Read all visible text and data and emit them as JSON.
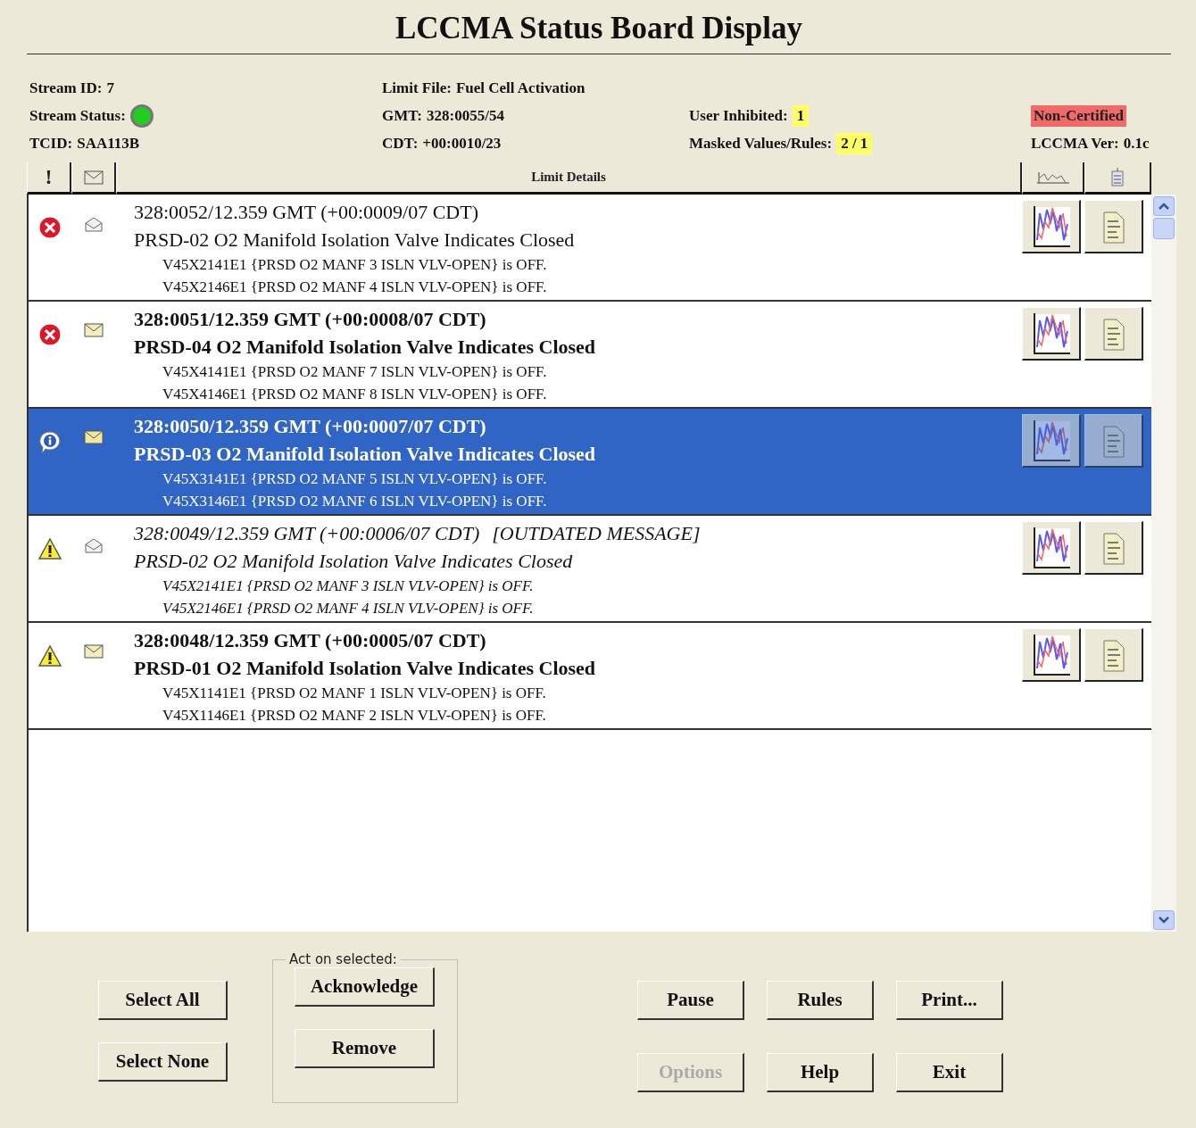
{
  "title": "LCCMA Status Board Display",
  "info": [
    [
      {
        "label": "Stream ID:",
        "value": "7",
        "kind": "plain"
      },
      {
        "label": "Limit File:",
        "value": "Fuel Cell Activation",
        "kind": "plain"
      }
    ],
    [
      {
        "label": "Stream Status:",
        "kind": "led",
        "color": "#22cc22"
      },
      {
        "label": "GMT:",
        "value": "328:0055/54",
        "kind": "plain"
      },
      {
        "label": "User Inhibited:",
        "value": "1",
        "kind": "highlight"
      },
      {
        "label": "Non-Certified",
        "kind": "alert"
      }
    ],
    [
      {
        "label": "TCID:",
        "value": "SAA113B",
        "kind": "plain"
      },
      {
        "label": "CDT:",
        "value": "+00:0010/23",
        "kind": "plain"
      },
      {
        "label": "Masked Values/Rules:",
        "value": "2 / 1",
        "kind": "highlight"
      },
      {
        "label": "LCCMA Ver:",
        "value": "0.1c",
        "kind": "plain"
      }
    ]
  ],
  "table": {
    "columns": [
      {
        "kind": "text",
        "label": "!"
      },
      {
        "kind": "envelope"
      },
      {
        "kind": "text",
        "label": "Limit Details"
      },
      {
        "kind": "chart"
      },
      {
        "kind": "doc"
      }
    ]
  },
  "messages": [
    {
      "kind": "error",
      "read": true,
      "outdated": false,
      "selected": false,
      "time": "328:0052/12.359 GMT (+00:0009/07 CDT)",
      "title": "PRSD-02 O2 Manifold Isolation Valve Indicates Closed",
      "details": [
        "V45X2141E1 {PRSD O2 MANF 3 ISLN VLV-OPEN} is OFF.",
        "V45X2146E1 {PRSD O2 MANF 4 ISLN VLV-OPEN} is OFF."
      ]
    },
    {
      "kind": "error",
      "read": false,
      "outdated": false,
      "selected": false,
      "time": "328:0051/12.359 GMT (+00:0008/07 CDT)",
      "title": "PRSD-04 O2 Manifold Isolation Valve Indicates Closed",
      "details": [
        "V45X4141E1 {PRSD O2 MANF 7 ISLN VLV-OPEN} is OFF.",
        "V45X4146E1 {PRSD O2 MANF 8 ISLN VLV-OPEN} is OFF."
      ]
    },
    {
      "kind": "info",
      "read": false,
      "outdated": false,
      "selected": true,
      "time": "328:0050/12.359 GMT (+00:0007/07 CDT)",
      "title": "PRSD-03 O2 Manifold Isolation Valve Indicates Closed",
      "details": [
        "V45X3141E1 {PRSD O2 MANF 5 ISLN VLV-OPEN} is OFF.",
        "V45X3146E1 {PRSD O2 MANF 6 ISLN VLV-OPEN} is OFF."
      ]
    },
    {
      "kind": "warning",
      "read": true,
      "outdated": true,
      "selected": false,
      "time": "328:0049/12.359 GMT (+00:0006/07 CDT)",
      "note": "[OUTDATED MESSAGE]",
      "title": "PRSD-02 O2 Manifold Isolation Valve Indicates Closed",
      "details": [
        "V45X2141E1 {PRSD O2 MANF 3 ISLN VLV-OPEN} is OFF.",
        "V45X2146E1 {PRSD O2 MANF 4 ISLN VLV-OPEN} is OFF."
      ]
    },
    {
      "kind": "warning",
      "read": false,
      "outdated": false,
      "selected": false,
      "time": "328:0048/12.359 GMT (+00:0005/07 CDT)",
      "title": "PRSD-01 O2 Manifold Isolation Valve Indicates Closed",
      "details": [
        "V45X1141E1 {PRSD O2 MANF 1 ISLN VLV-OPEN} is OFF.",
        "V45X1146E1 {PRSD O2 MANF 2 ISLN VLV-OPEN} is OFF."
      ]
    }
  ],
  "selection_buttons": [
    {
      "label": "Select All",
      "disabled": false
    },
    {
      "label": "Select None",
      "disabled": false
    }
  ],
  "act_on_selected": {
    "legend": "Act on selected:",
    "buttons": [
      {
        "label": "Acknowledge",
        "disabled": false
      },
      {
        "label": "Remove",
        "disabled": false
      }
    ]
  },
  "buttons": [
    {
      "label": "Pause",
      "disabled": false
    },
    {
      "label": "Rules",
      "disabled": false
    },
    {
      "label": "Print...",
      "disabled": false
    },
    {
      "label": "Options",
      "disabled": true
    },
    {
      "label": "Help",
      "disabled": false
    },
    {
      "label": "Exit",
      "disabled": false
    }
  ]
}
